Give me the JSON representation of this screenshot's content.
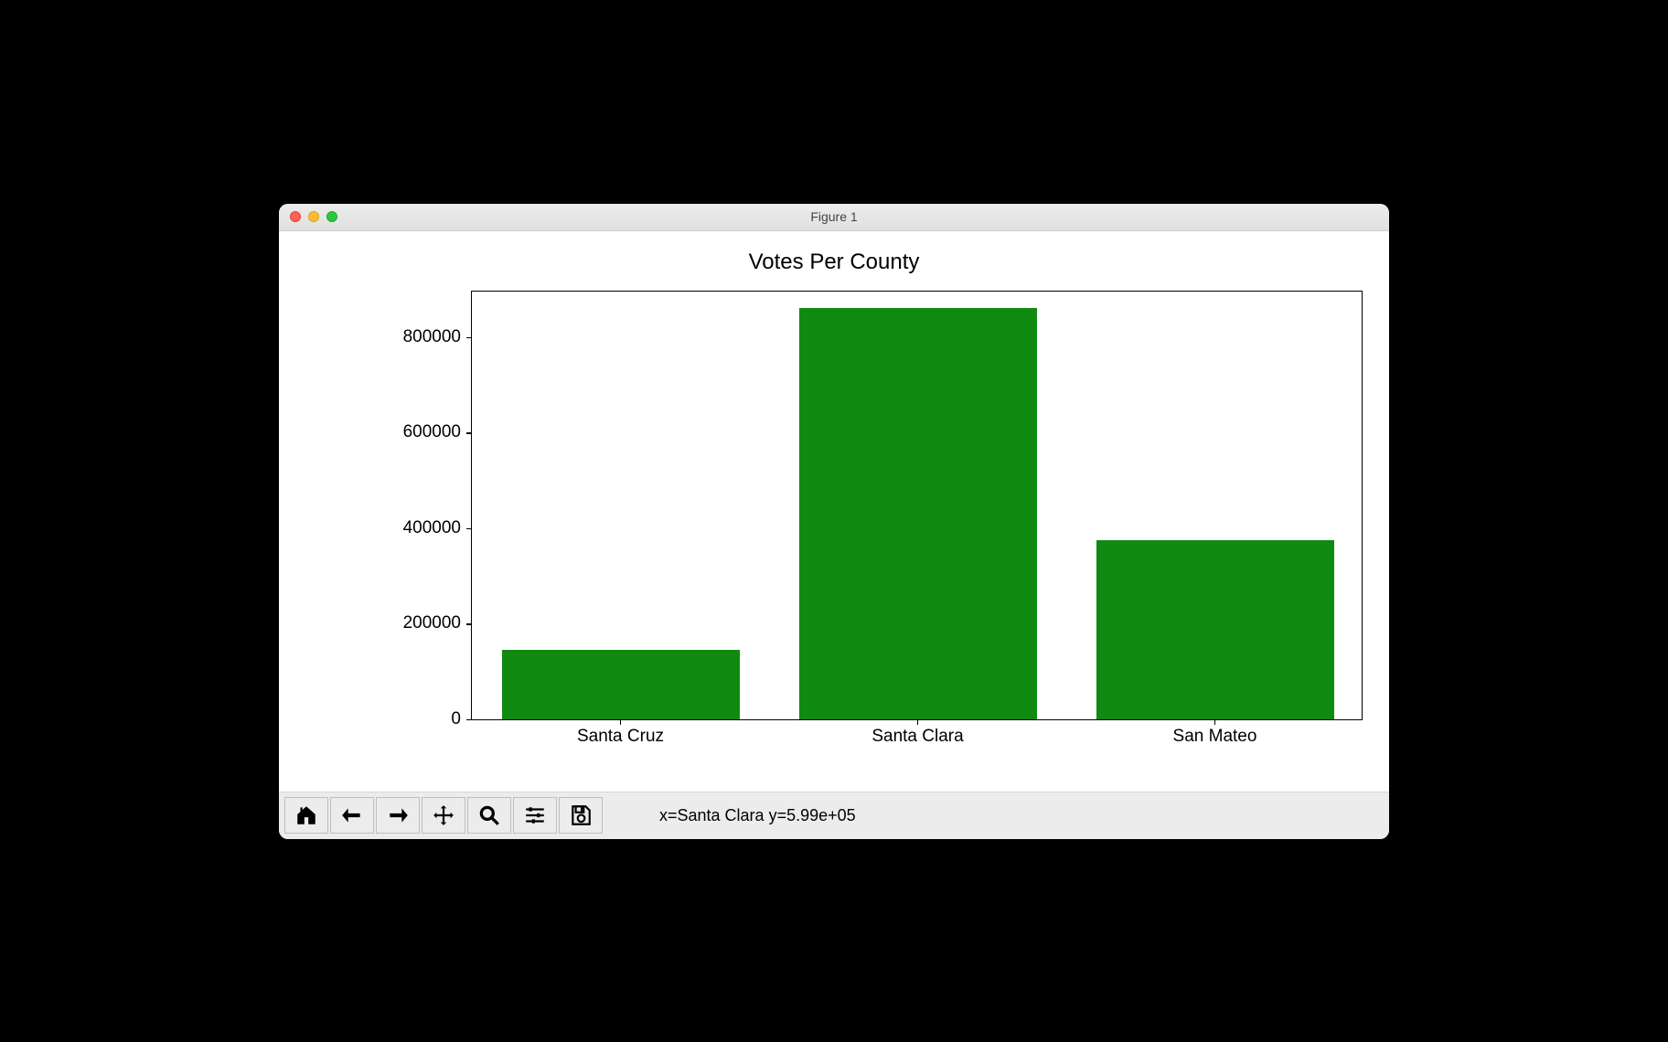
{
  "window": {
    "title": "Figure 1"
  },
  "chart_data": {
    "type": "bar",
    "title": "Votes Per County",
    "categories": [
      "Santa Cruz",
      "Santa Clara",
      "San Mateo"
    ],
    "values": [
      145000,
      860000,
      375000
    ],
    "ylim": [
      0,
      900000
    ],
    "yticks": [
      0,
      200000,
      400000,
      600000,
      800000
    ],
    "bar_color": "#108a11",
    "xlabel": "",
    "ylabel": ""
  },
  "toolbar": {
    "status": "x=Santa Clara y=5.99e+05",
    "buttons": {
      "home": "Home",
      "back": "Back",
      "forward": "Forward",
      "pan": "Pan",
      "zoom": "Zoom",
      "configure": "Configure subplots",
      "save": "Save"
    }
  }
}
